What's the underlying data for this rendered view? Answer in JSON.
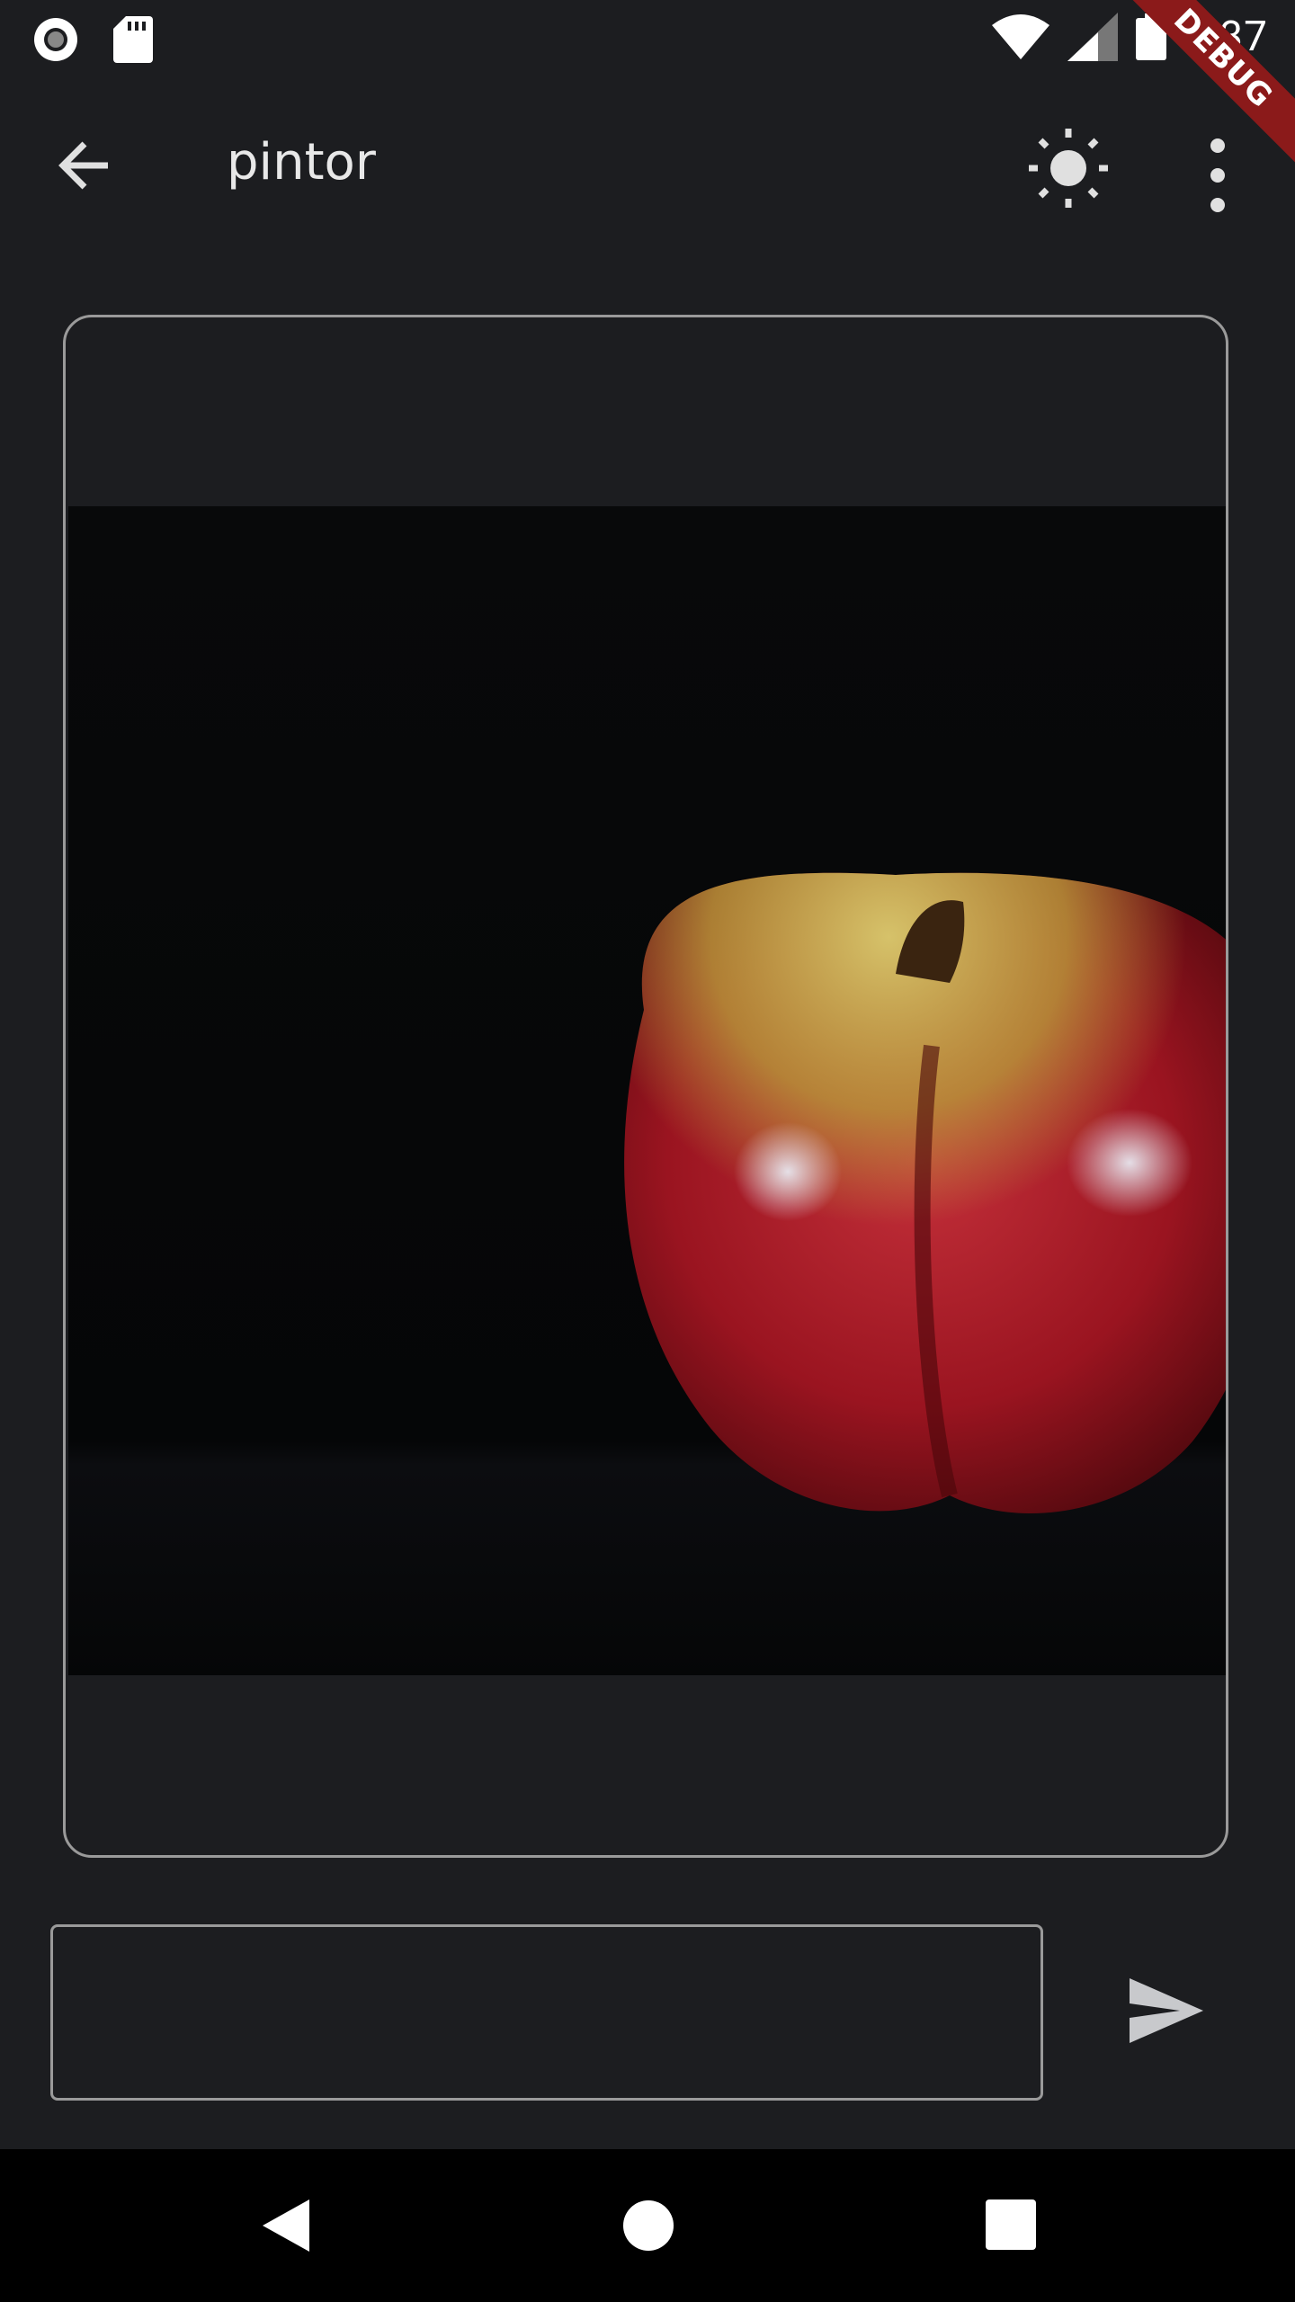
{
  "status_bar": {
    "time": "2:37",
    "debug_label": "DEBUG"
  },
  "app_bar": {
    "title": "pintor",
    "back_icon": "arrow-back-icon",
    "theme_icon": "sun-icon",
    "menu_icon": "more-vert-icon"
  },
  "canvas": {
    "image_subject": "red apple on black background"
  },
  "composer": {
    "value": "",
    "send_icon": "send-icon"
  },
  "nav_bar": {
    "back_icon": "nav-back-icon",
    "home_icon": "nav-home-icon",
    "recents_icon": "nav-recents-icon"
  },
  "colors": {
    "background": "#1c1d20",
    "border": "#9a9a9a",
    "debug_ribbon": "#8b1a1a",
    "navbar": "#000000"
  }
}
